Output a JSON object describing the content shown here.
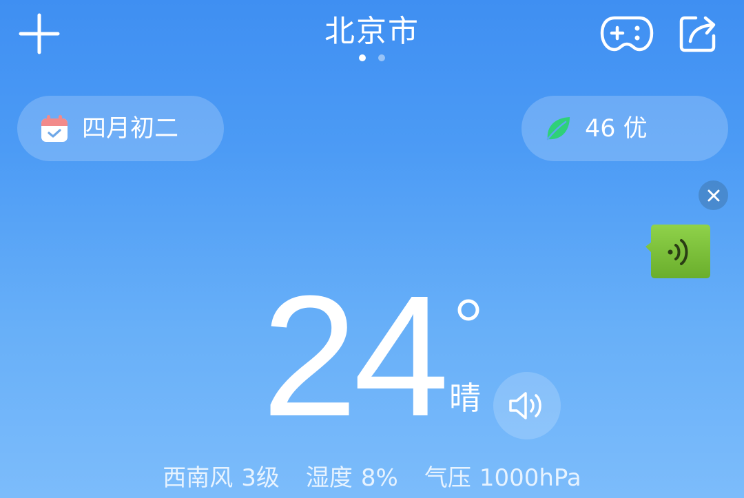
{
  "header": {
    "city": "北京市",
    "page_count": 2,
    "active_page": 0
  },
  "lunar": {
    "label": "四月初二"
  },
  "aqi": {
    "label": "46 优",
    "color": "#2ed178"
  },
  "current": {
    "temperature": "24",
    "condition": "晴"
  },
  "details": {
    "wind_label": "西南风",
    "wind_value": "3级",
    "humidity_label": "湿度",
    "humidity_value": "8%",
    "pressure_label": "气压",
    "pressure_value": "1000hPa"
  },
  "colors": {
    "voice_bubble": "#7cc03a",
    "calendar_icon": "#f28a8a"
  },
  "icons": {
    "add": "plus-icon",
    "game": "gamepad-icon",
    "share": "share-icon",
    "calendar": "calendar-check-icon",
    "leaf": "leaf-icon",
    "close": "close-icon",
    "voice": "sound-wave-icon",
    "speaker": "speaker-icon"
  }
}
